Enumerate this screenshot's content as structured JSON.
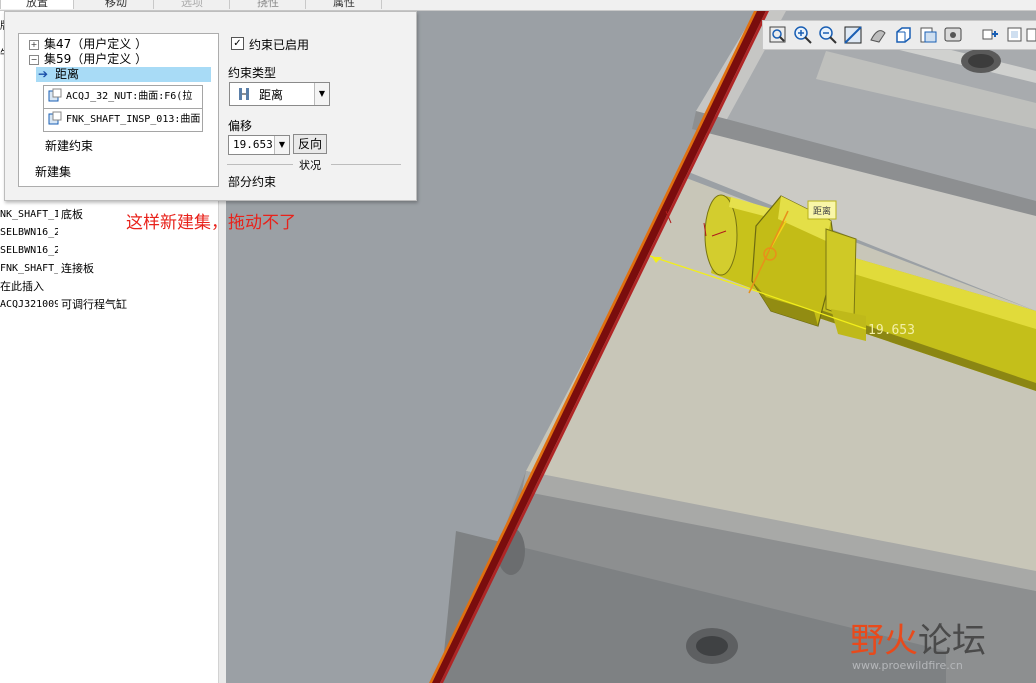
{
  "tabs": [
    "放置",
    "移动",
    "选项",
    "挠性",
    "属性"
  ],
  "tree": {
    "edge_labels": [
      "版",
      "牛"
    ],
    "rows": [
      {
        "name": "NK_SHAFT_I",
        "note": "底板"
      },
      {
        "name": "SELBWN16_2",
        "note": ""
      },
      {
        "name": "SELBWN16_2",
        "note": ""
      },
      {
        "name": "FNK_SHAFT_",
        "note": "连接板"
      },
      {
        "name": "在此插入",
        "note": ""
      },
      {
        "name": "ACQJ321009",
        "note": "可调行程气缸"
      }
    ]
  },
  "panel": {
    "sets": [
      {
        "toggle": "+",
        "label": "集47（用户定义 ）"
      },
      {
        "toggle": "−",
        "label": "集59（用户定义 ）"
      }
    ],
    "selected_constraint": "距离",
    "references": [
      "ACQJ_32_NUT:曲面:F6(拉",
      "FNK_SHAFT_INSP_013:曲面"
    ],
    "new_constraint": "新建约束",
    "new_set": "新建集",
    "enabled_label": "约束已启用",
    "enabled": true,
    "type_label": "约束类型",
    "type_value": "距离",
    "offset_label": "偏移",
    "offset_value": "19.653",
    "flip_label": "反向",
    "status_label": "状况",
    "status_value": "部分约束"
  },
  "graphics": {
    "dimension_value": "19.653",
    "dimension_tag": "距离",
    "toolbar_icons": [
      "zoom-fit-icon",
      "zoom-in-icon",
      "zoom-out-icon",
      "repaint-icon",
      "saved-orientation-icon",
      "view-manager-icon",
      "display-style-icon",
      "perspective-icon",
      "spin-center-icon",
      "datum-display-icon",
      "annotation-display-icon",
      "more-icon"
    ]
  },
  "annotation": "这样新建集，拖动不了",
  "watermark": {
    "title_a": "野",
    "title_b": "火",
    "title_c": "论坛",
    "sub": "www.proewildfire.cn"
  },
  "colors": {
    "selection": "#a8dbf6",
    "part": "#c9c218",
    "annotation": "#e8221b",
    "edge": "#7a0d0d"
  }
}
